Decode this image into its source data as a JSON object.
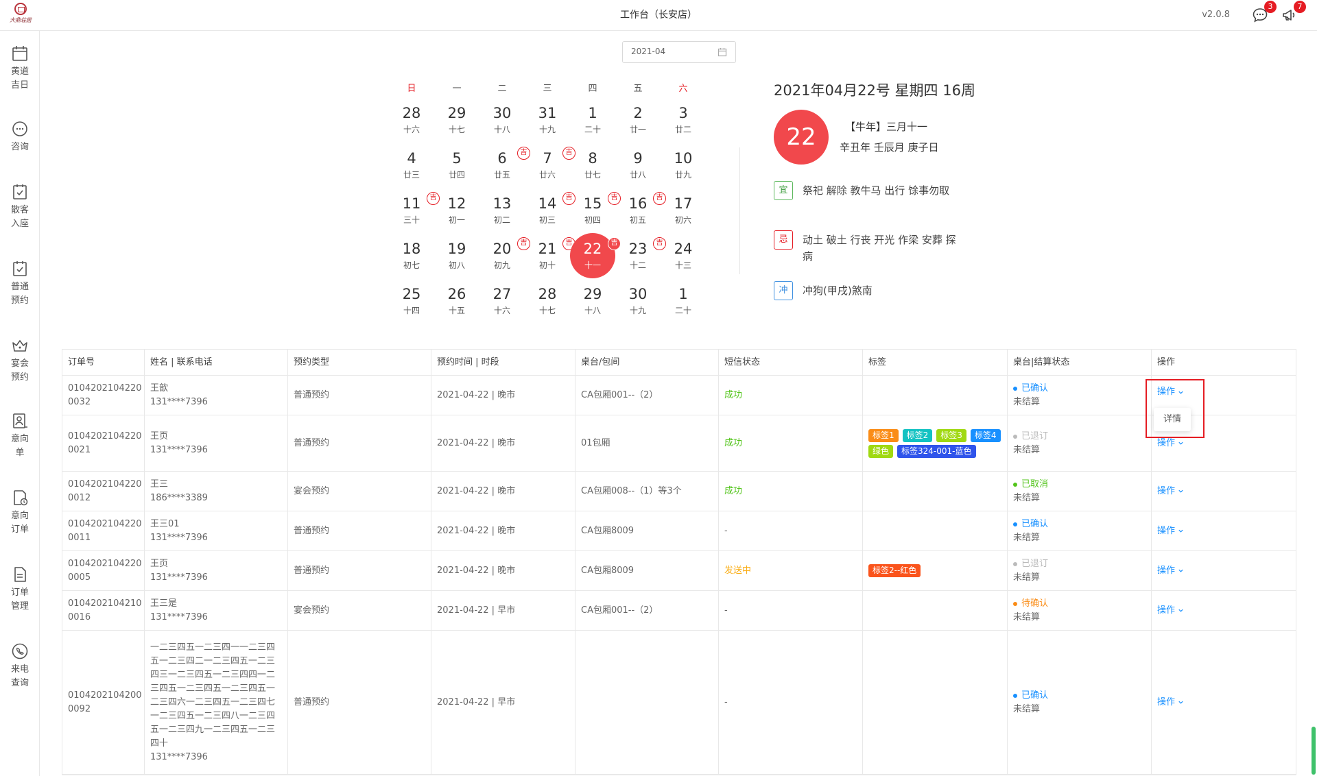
{
  "app": {
    "logo_text": "大鼎荘居",
    "title": "工作台（长安店）",
    "version": "v2.0.8",
    "messages_badge": "3",
    "notices_badge": "7"
  },
  "sidebar": {
    "items": [
      {
        "label": "黄道吉日",
        "icon": "calendar-icon"
      },
      {
        "label": "咨询",
        "icon": "chat-icon"
      },
      {
        "label": "散客入座",
        "icon": "checklist-icon"
      },
      {
        "label": "普通预约",
        "icon": "checklist-icon"
      },
      {
        "label": "宴会预约",
        "icon": "crown-icon"
      },
      {
        "label": "意向单",
        "icon": "person-list-icon"
      },
      {
        "label": "意向订单",
        "icon": "doc-clock-icon"
      },
      {
        "label": "订单管理",
        "icon": "document-icon"
      },
      {
        "label": "来电查询",
        "icon": "phone-icon"
      }
    ]
  },
  "month_picker": {
    "value": "2021-04"
  },
  "calendar": {
    "weekdays": [
      "日",
      "一",
      "二",
      "三",
      "四",
      "五",
      "六"
    ],
    "ji_symbol": "吉",
    "days": [
      {
        "n": "28",
        "l": "十六"
      },
      {
        "n": "29",
        "l": "十七"
      },
      {
        "n": "30",
        "l": "十八"
      },
      {
        "n": "31",
        "l": "十九"
      },
      {
        "n": "1",
        "l": "二十"
      },
      {
        "n": "2",
        "l": "廿一"
      },
      {
        "n": "3",
        "l": "廿二"
      },
      {
        "n": "4",
        "l": "廿三"
      },
      {
        "n": "5",
        "l": "廿四"
      },
      {
        "n": "6",
        "l": "廿五",
        "ji": true
      },
      {
        "n": "7",
        "l": "廿六",
        "ji": true
      },
      {
        "n": "8",
        "l": "廿七"
      },
      {
        "n": "9",
        "l": "廿八"
      },
      {
        "n": "10",
        "l": "廿九"
      },
      {
        "n": "11",
        "l": "三十",
        "ji": true
      },
      {
        "n": "12",
        "l": "初一"
      },
      {
        "n": "13",
        "l": "初二"
      },
      {
        "n": "14",
        "l": "初三",
        "ji": true
      },
      {
        "n": "15",
        "l": "初四",
        "ji": true
      },
      {
        "n": "16",
        "l": "初五",
        "ji": true
      },
      {
        "n": "17",
        "l": "初六"
      },
      {
        "n": "18",
        "l": "初七"
      },
      {
        "n": "19",
        "l": "初八"
      },
      {
        "n": "20",
        "l": "初九",
        "ji": true
      },
      {
        "n": "21",
        "l": "初十",
        "ji": true
      },
      {
        "n": "22",
        "l": "十一",
        "ji": true,
        "selected": true
      },
      {
        "n": "23",
        "l": "十二",
        "ji": true
      },
      {
        "n": "24",
        "l": "十三"
      },
      {
        "n": "25",
        "l": "十四"
      },
      {
        "n": "26",
        "l": "十五"
      },
      {
        "n": "27",
        "l": "十六"
      },
      {
        "n": "28",
        "l": "十七"
      },
      {
        "n": "29",
        "l": "十八"
      },
      {
        "n": "30",
        "l": "十九"
      },
      {
        "n": "1",
        "l": "二十"
      }
    ]
  },
  "date_info": {
    "heading": "2021年04月22号 星期四 16周",
    "day": "22",
    "lunar": "【牛年】三月十一",
    "ganzhi": "辛丑年 壬辰月 庚子日",
    "yi_label": "宜",
    "yi_text": "祭祀 解除 教牛马 出行 馀事勿取",
    "ji_label": "忌",
    "ji_text": "动土 破土 行丧 开光 作梁 安葬 探病",
    "chong_label": "冲",
    "chong_text": "冲狗(甲戌)煞南"
  },
  "table": {
    "headers": [
      "订单号",
      "姓名 | 联系电话",
      "预约类型",
      "预约时间 | 时段",
      "桌台/包间",
      "短信状态",
      "标签",
      "桌台|结算状态",
      "操作"
    ],
    "op_label": "操作",
    "dropdown_item": "详情",
    "settle": "未结算",
    "rows": [
      {
        "id1": "0104202104220",
        "id2": "0032",
        "name": "王歆",
        "phone": "131****7396",
        "type": "普通预约",
        "time": "2021-04-22 | 晚市",
        "table": "CA包厢001--（2）",
        "sms": "成功",
        "sms_class": "sms-ok",
        "tags": [],
        "status": "已确认",
        "status_class": "st-blue"
      },
      {
        "id1": "0104202104220",
        "id2": "0021",
        "name": "王页",
        "phone": "131****7396",
        "type": "普通预约",
        "time": "2021-04-22 | 晚市",
        "table": "01包厢",
        "sms": "成功",
        "sms_class": "sms-ok",
        "tags": [
          {
            "t": "标签1",
            "c": "#fa8c16"
          },
          {
            "t": "标签2",
            "c": "#13c2c2"
          },
          {
            "t": "标签3",
            "c": "#a0d911"
          },
          {
            "t": "标签4",
            "c": "#1890ff"
          },
          {
            "t": "绿色",
            "c": "#a0d911"
          },
          {
            "t": "标签324-001-蓝色",
            "c": "#2f54eb"
          }
        ],
        "status": "已退订",
        "status_class": "st-gray"
      },
      {
        "id1": "0104202104220",
        "id2": "0012",
        "name": "王三",
        "phone": "186****3389",
        "type": "宴会预约",
        "time": "2021-04-22 | 晚市",
        "table": "CA包厢008--（1）等3个",
        "sms": "成功",
        "sms_class": "sms-ok",
        "tags": [],
        "status": "已取消",
        "status_class": "st-green"
      },
      {
        "id1": "0104202104220",
        "id2": "0011",
        "name": "王三01",
        "phone": "131****7396",
        "type": "普通预约",
        "time": "2021-04-22 | 晚市",
        "table": "CA包厢8009",
        "sms": "-",
        "sms_class": "",
        "tags": [],
        "status": "已确认",
        "status_class": "st-blue"
      },
      {
        "id1": "0104202104220",
        "id2": "0005",
        "name": "王页",
        "phone": "131****7396",
        "type": "普通预约",
        "time": "2021-04-22 | 晚市",
        "table": "CA包厢8009",
        "sms": "发送中",
        "sms_class": "sms-sending",
        "tags": [
          {
            "t": "标签2--红色",
            "c": "#fa541c"
          }
        ],
        "status": "已退订",
        "status_class": "st-gray"
      },
      {
        "id1": "0104202104210",
        "id2": "0016",
        "name": "王三是",
        "phone": "131****7396",
        "type": "宴会预约",
        "time": "2021-04-22 | 早市",
        "table": "CA包厢001--（2）",
        "sms": "-",
        "sms_class": "",
        "tags": [],
        "status": "待确认",
        "status_class": "st-orange"
      },
      {
        "id1": "0104202104200",
        "id2": "0092",
        "name": "一二三四五一二三四一一二三四五一二三四二一二三四五一二三四三一二三四五一二三四四一二三四五一二三四五一二三四五一二三四六一二三四五一二三四七一二三四五一二三四八一二三四五一二三四九一二三四五一二三四十",
        "phone": "131****7396",
        "type": "普通预约",
        "time": "2021-04-22 | 早市",
        "table": "",
        "sms": "-",
        "sms_class": "",
        "tags": [],
        "status": "已确认",
        "status_class": "st-blue"
      }
    ]
  },
  "colors": {
    "accent": "#f1484c",
    "link": "#1890ff",
    "success": "#52c41a"
  }
}
